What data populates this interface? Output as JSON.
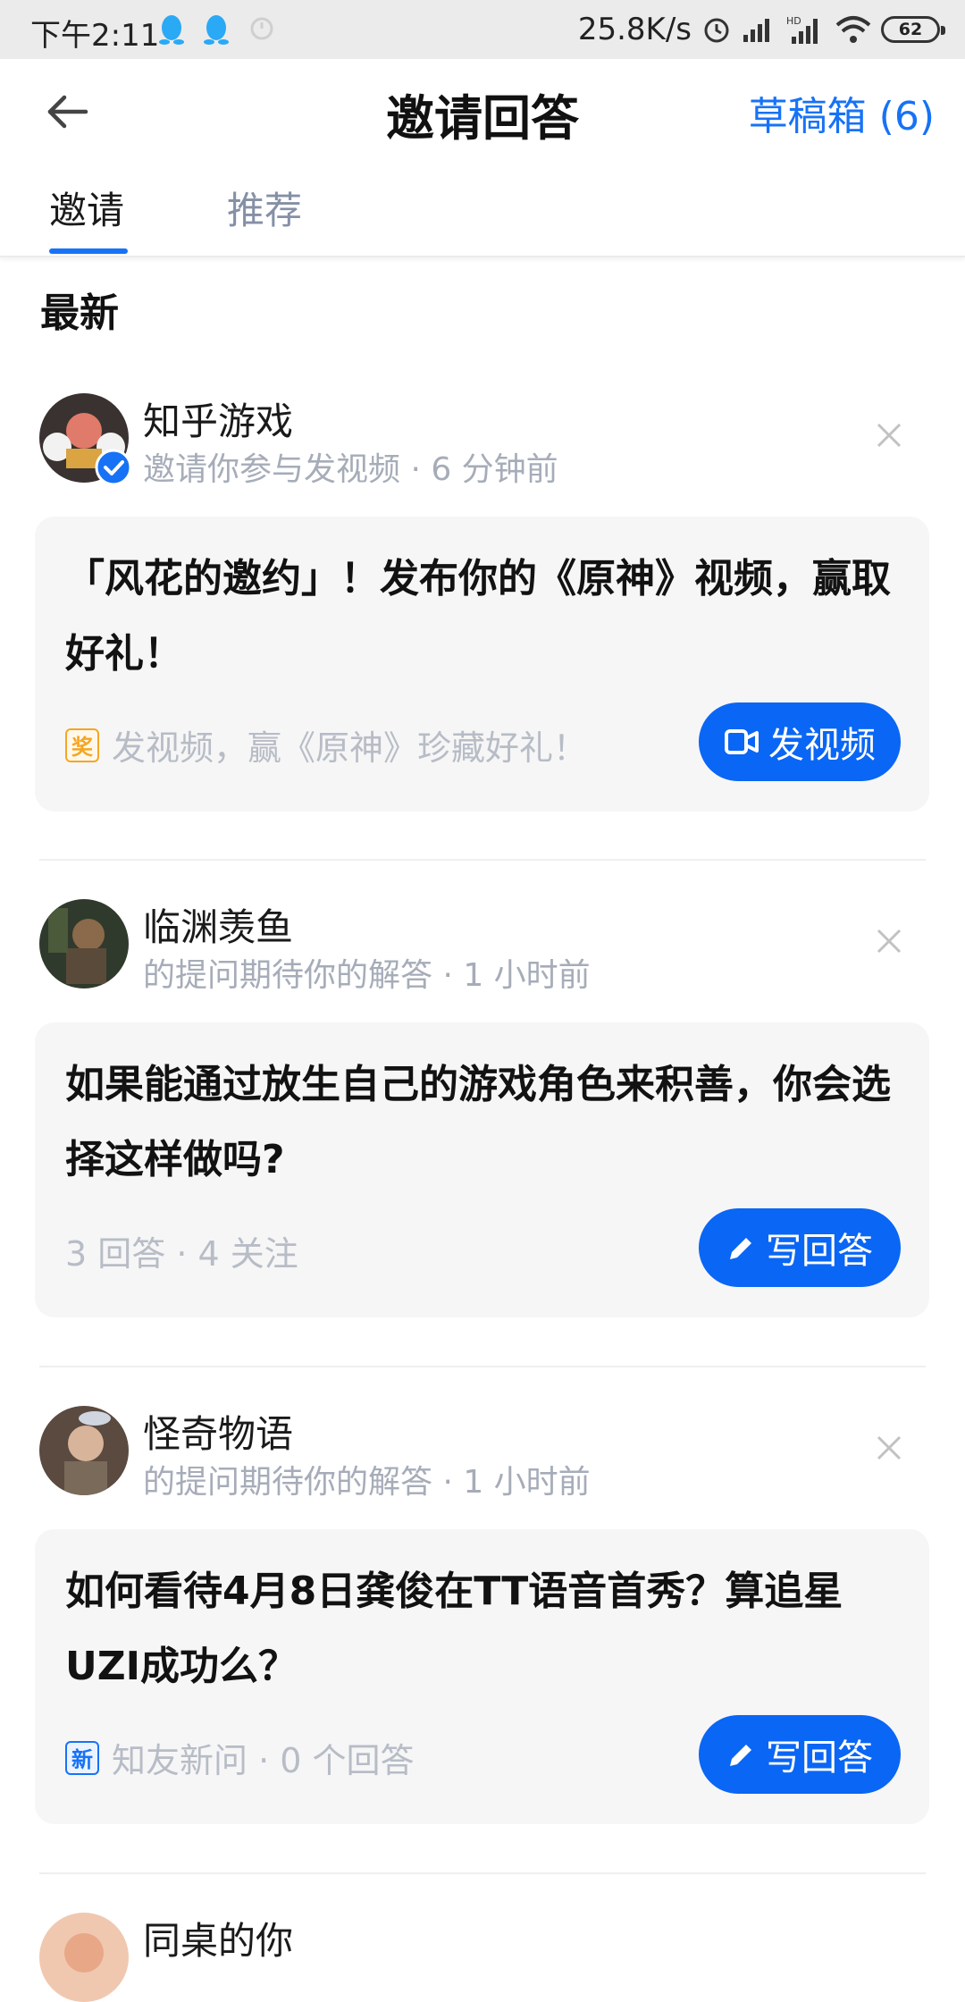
{
  "status_bar": {
    "time": "下午2:11",
    "net_speed": "25.8K/s",
    "battery": "62"
  },
  "header": {
    "title": "邀请回答",
    "drafts": "草稿箱 (6)"
  },
  "tabs": [
    {
      "label": "邀请",
      "active": true
    },
    {
      "label": "推荐",
      "active": false
    }
  ],
  "section_title": "最新",
  "items": [
    {
      "user": "知乎游戏",
      "subtitle": "邀请你参与发视频 · 6 分钟前",
      "question": "「风花的邀约」！发布你的《原神》视频，赢取好礼！",
      "meta_badge": "奖",
      "meta": "发视频，赢《原神》珍藏好礼！",
      "action": "发视频"
    },
    {
      "user": "临渊羡鱼",
      "subtitle": "的提问期待你的解答 · 1 小时前",
      "question": "如果能通过放生自己的游戏角色来积善，你会选择这样做吗?",
      "meta": "3 回答 · 4 关注",
      "action": "写回答"
    },
    {
      "user": "怪奇物语",
      "subtitle": "的提问期待你的解答 · 1 小时前",
      "question": "如何看待4月8日龚俊在TT语音首秀？算追星UZI成功么？",
      "meta_badge": "新",
      "meta": "知友新问 · 0 个回答",
      "action": "写回答"
    },
    {
      "user": "同桌的你"
    }
  ],
  "colors": {
    "accent": "#1772f6",
    "button": "#0a66f5"
  }
}
